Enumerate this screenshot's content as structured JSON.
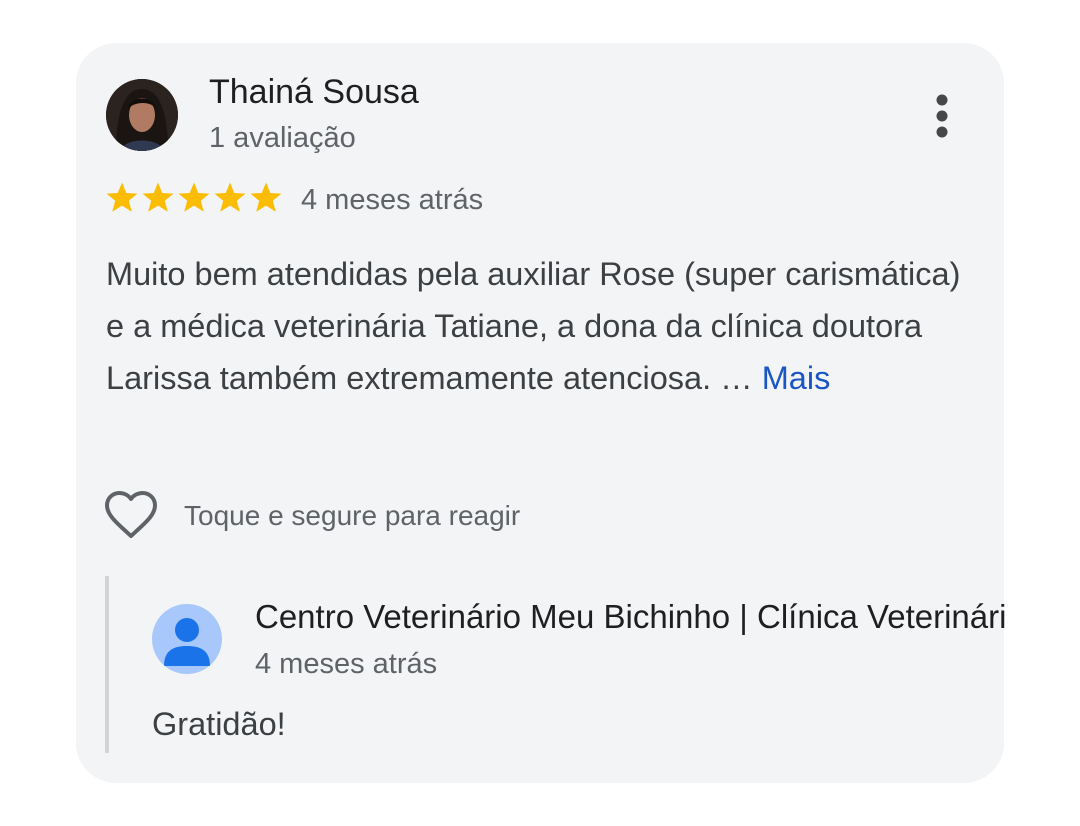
{
  "review": {
    "reviewer_name": "Thainá Sousa",
    "review_count": "1 avaliação",
    "rating": 5,
    "max_rating": 5,
    "time": "4 meses atrás",
    "text": "Muito bem atendidas pela auxiliar Rose (super carismática) e a médica veterinária Tatiane, a dona da clínica doutora Larissa também extremamente atenciosa. …",
    "more_label": "Mais",
    "react_label": "Toque e segure para reagir",
    "star_color": "#fbbc04",
    "link_color": "#1a56c4"
  },
  "owner_reply": {
    "name": "Centro Veterinário Meu Bichinho | Clínica Veterinária",
    "time": "4 meses atrás",
    "text": "Gratidão!",
    "avatar_color": "#a8c7fa",
    "avatar_figure_color": "#1a73e8"
  },
  "icons": {
    "menu": "more-vert-icon",
    "star": "star-icon",
    "heart": "heart-outline-icon",
    "owner_avatar": "person-icon"
  }
}
